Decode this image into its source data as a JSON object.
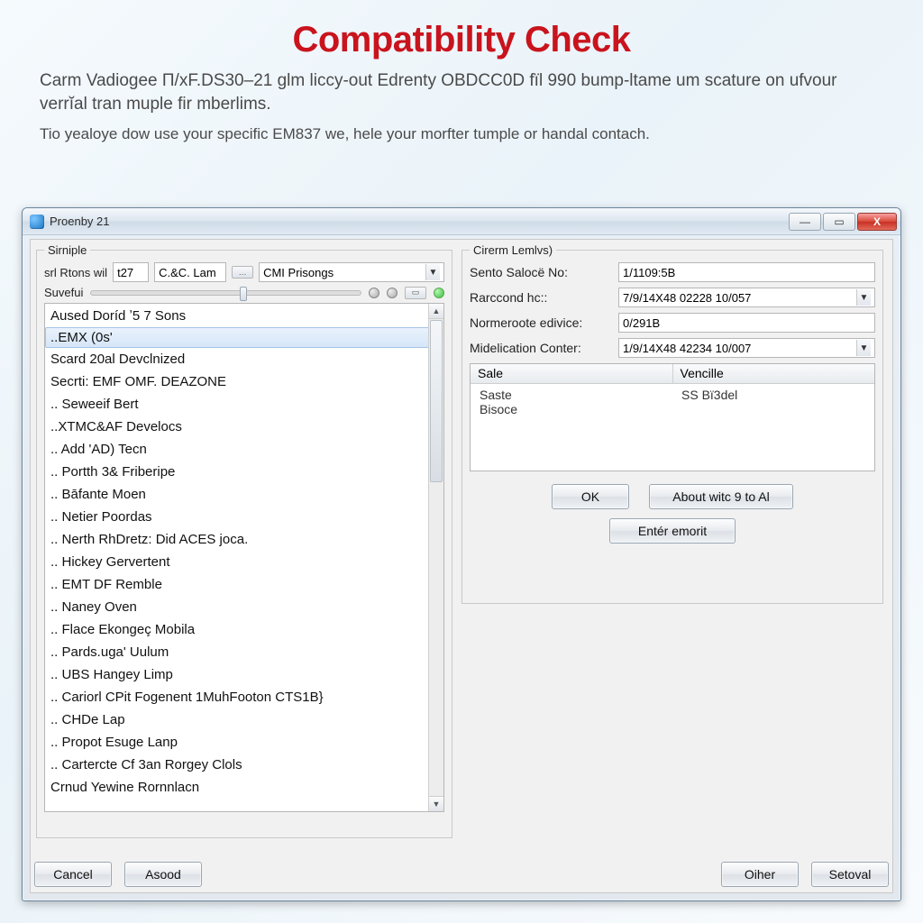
{
  "header": {
    "title": "Compatibility Check",
    "subtitle": "Carm Vadiogee П/xF.DS30–21 glm liccy-out Edrenty OBDCC0D fïl 990 bump-ltame um scature on ufvour verrĭal tran muple fir mberlims.",
    "subtitle2": "Tio yealoye dow use your specific EM837 we, hele your morfter tumple or handal contach."
  },
  "window": {
    "title": "Proenby 21",
    "buttons": {
      "minimize": "—",
      "maximize": "▭",
      "close": "X"
    }
  },
  "left_group": {
    "legend": "Sirniple",
    "row1": {
      "label": "srl Rtons wil",
      "input1_value": "t27",
      "input2_value": "C.&C. Lam",
      "combo_value": "CMI Prisongs"
    },
    "suvefui_label": "Suvefui",
    "list": [
      "Aused Doríd ʼ5 7 Sons",
      "..EMX (0s'",
      "Scard 20al Devclnized",
      "Secrti: EMF OMF. DEAZONE",
      ".. Seweeif Bert",
      "..XTMC&AF Develocs",
      ".. Add 'AD) Tecn",
      ".. Portth 3& Friberipe",
      ".. Bāfante Moen",
      ".. Netier Poordas",
      ".. Nerth RhDretz: Did ACES joca.",
      ".. Hickey Gervertent",
      ".. EMT DF Remble",
      ".. Naney Oven",
      ".. Flace Ekongeç Mobila",
      ".. Pards.uga' Uulum",
      ".. UBS Hangey Limp",
      ".. Cariorl CPit Fogenent 1MuhFooton CTS1B}",
      ".. CHDe Lap",
      ".. Propot Esuge Lanp",
      ".. Cartercte Cf 3an Rorgey Clols",
      "   Crnud Yewine Rornnlacn"
    ],
    "selected_index": 1
  },
  "right_group": {
    "legend": "Cirerm Lemlvs)",
    "rows": [
      {
        "label": "Sento Salocë No:",
        "value": "1/1109:5B",
        "type": "text"
      },
      {
        "label": "Rarccond hc::",
        "value": "7/9/14X48 02228 10/057",
        "type": "combo"
      },
      {
        "label": "Normeroote edivice:",
        "value": "0/291B",
        "type": "text"
      },
      {
        "label": "Midelication Conter:",
        "value": "1/9/14X48 42234 10/007",
        "type": "combo"
      }
    ],
    "grid": {
      "headers": [
        "Sale",
        "Vencille"
      ],
      "cells": [
        "Saste\nBisoce",
        "SS Bï3del"
      ]
    },
    "buttons": {
      "ok": "OK",
      "about": "About witc 9 to Al",
      "enter": "Entér emorit"
    }
  },
  "footer": {
    "cancel": "Cancel",
    "asod": "Asood",
    "other": "Oiher",
    "setoval": "Setoval"
  }
}
